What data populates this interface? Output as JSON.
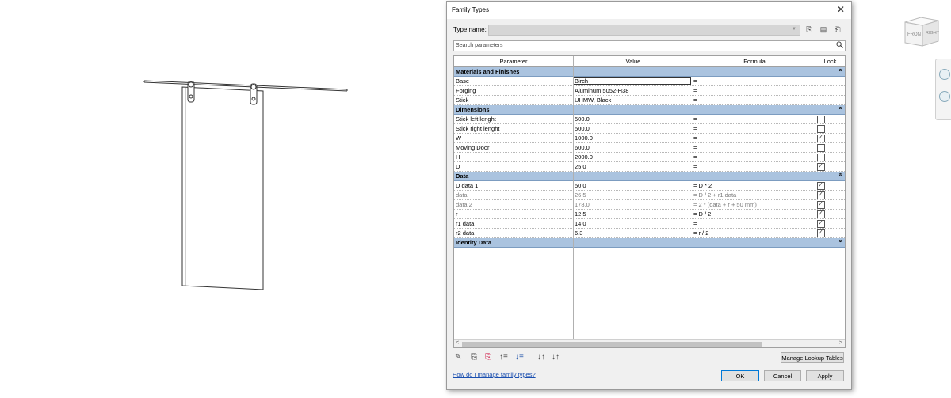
{
  "viewcube": {
    "front_label": "FRONT",
    "right_label": "RIGHT"
  },
  "dialog": {
    "title": "Family Types",
    "close_icon": "close-icon",
    "type_name_label": "Type name:",
    "type_name_value": "",
    "toolbar_icons": [
      "new-type-icon",
      "rename-type-icon",
      "delete-type-icon"
    ],
    "search_placeholder": "Search parameters",
    "columns": {
      "parameter": "Parameter",
      "value": "Value",
      "formula": "Formula",
      "lock": "Lock"
    },
    "groups": [
      {
        "name": "Materials and Finishes",
        "rows": [
          {
            "parameter": "Base",
            "value": "Birch",
            "formula": "=",
            "lock": null,
            "editing": true
          },
          {
            "parameter": "Forging",
            "value": "Aluminum 5052-H38",
            "formula": "=",
            "lock": null
          },
          {
            "parameter": "Stick",
            "value": "UHMW, Black",
            "formula": "=",
            "lock": null
          }
        ]
      },
      {
        "name": "Dimensions",
        "rows": [
          {
            "parameter": "Stick left lenght",
            "value": "500.0",
            "formula": "=",
            "lock": false
          },
          {
            "parameter": "Stick right lenght",
            "value": "500.0",
            "formula": "=",
            "lock": false
          },
          {
            "parameter": "W",
            "value": "1000.0",
            "formula": "=",
            "lock": true
          },
          {
            "parameter": "Moving Door",
            "value": "600.0",
            "formula": "=",
            "lock": false
          },
          {
            "parameter": "H",
            "value": "2000.0",
            "formula": "=",
            "lock": false
          },
          {
            "parameter": "D",
            "value": "25.0",
            "formula": "=",
            "lock": true
          }
        ]
      },
      {
        "name": "Data",
        "rows": [
          {
            "parameter": "D data 1",
            "value": "50.0",
            "formula": "= D * 2",
            "lock": true
          },
          {
            "parameter": "data",
            "value": "26.5",
            "formula": "= D / 2 + r1 data",
            "lock": true,
            "dim": true
          },
          {
            "parameter": "data 2",
            "value": "178.0",
            "formula": "= 2 * (data + r + 50 mm)",
            "lock": true,
            "dim": true
          },
          {
            "parameter": "r",
            "value": "12.5",
            "formula": "= D / 2",
            "lock": true
          },
          {
            "parameter": "r1 data",
            "value": "14.0",
            "formula": "=",
            "lock": true
          },
          {
            "parameter": "r2 data",
            "value": "6.3",
            "formula": "= r / 2",
            "lock": true
          }
        ]
      },
      {
        "name": "Identity Data",
        "collapsed": true,
        "rows": []
      }
    ],
    "bottom_tool_icons": [
      "edit-parameter-icon",
      "new-parameter-icon",
      "delete-parameter-icon",
      "move-up-icon",
      "move-down-icon",
      "sort-ascending-icon",
      "sort-descending-icon"
    ],
    "manage_lookup_label": "Manage Lookup Tables",
    "help_link": "How do I manage family types?",
    "ok_label": "OK",
    "cancel_label": "Cancel",
    "apply_label": "Apply"
  }
}
